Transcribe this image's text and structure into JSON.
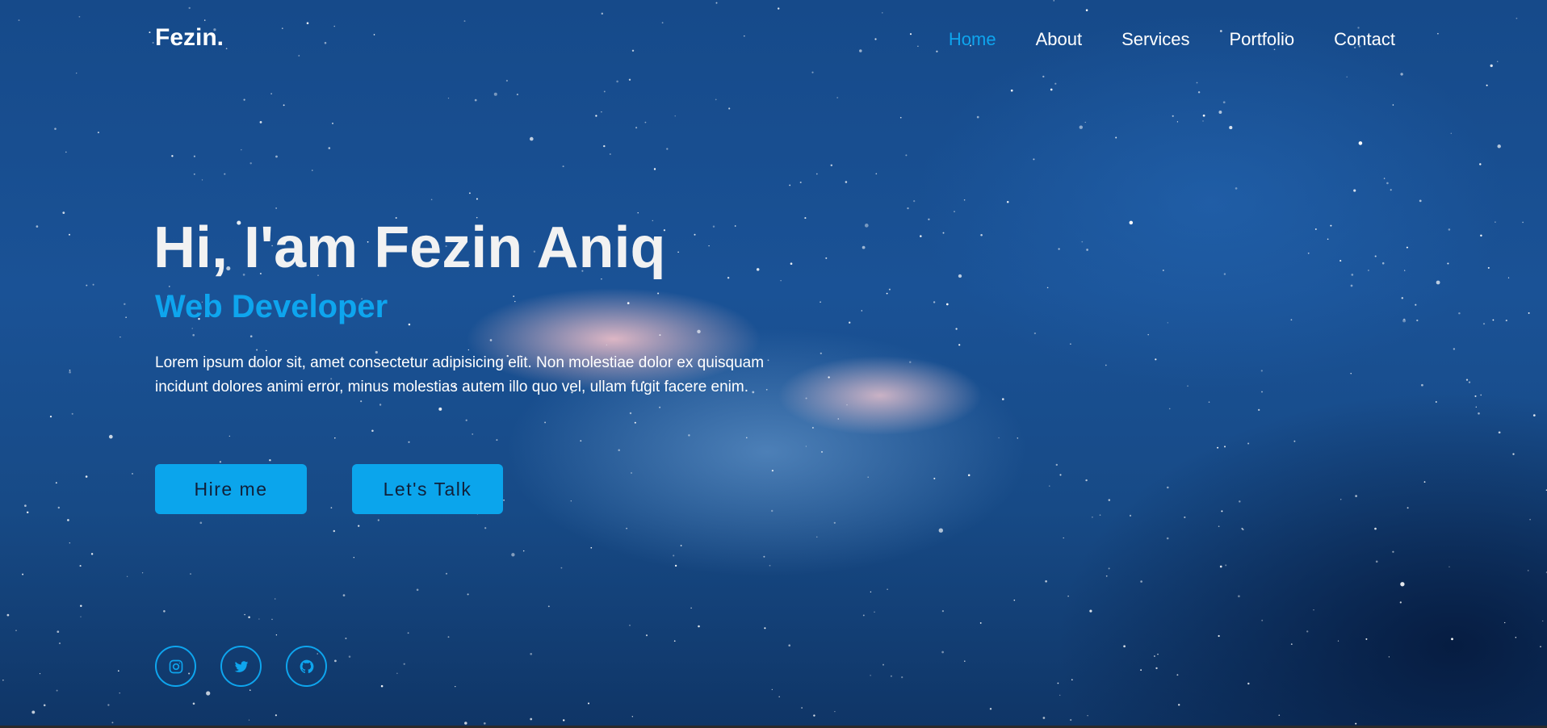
{
  "brand": {
    "logo": "Fezin."
  },
  "nav": {
    "items": [
      {
        "label": "Home",
        "active": true
      },
      {
        "label": "About",
        "active": false
      },
      {
        "label": "Services",
        "active": false
      },
      {
        "label": "Portfolio",
        "active": false
      },
      {
        "label": "Contact",
        "active": false
      }
    ]
  },
  "hero": {
    "title": "Hi, I'am Fezin Aniq",
    "subtitle": "Web Developer",
    "description": "Lorem ipsum dolor sit, amet consectetur adipisicing elit. Non molestiae dolor ex quisquam incidunt dolores animi error, minus molestias autem illo quo vel, ullam fugit facere enim.",
    "buttons": {
      "hire_label": "Hire me",
      "talk_label": "Let's Talk"
    }
  },
  "socials": [
    {
      "icon": "instagram-icon"
    },
    {
      "icon": "twitter-icon"
    },
    {
      "icon": "github-icon"
    }
  ],
  "colors": {
    "accent": "#0ea5ee",
    "text": "#ffffff",
    "button_text": "#10203a"
  }
}
